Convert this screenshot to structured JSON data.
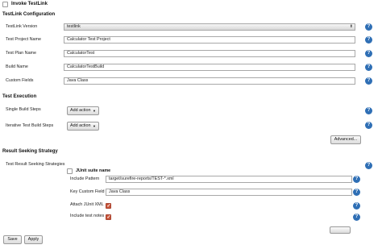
{
  "invoke": {
    "label": "Invoke TestLink"
  },
  "config": {
    "header": "TestLink Configuration",
    "version": {
      "label": "TestLink Version",
      "value": "testlink"
    },
    "project": {
      "label": "Test Project Name",
      "value": "Calculator Test Project"
    },
    "plan": {
      "label": "Test Plan Name",
      "value": "CalculatorTest"
    },
    "build": {
      "label": "Build Name",
      "value": "CalculatorTestBuild"
    },
    "custom": {
      "label": "Custom Fields",
      "value": "Java Class"
    }
  },
  "execution": {
    "header": "Test Execution",
    "single": {
      "label": "Single Build Steps",
      "button": "Add action"
    },
    "iterative": {
      "label": "Iterative Test Build Steps",
      "button": "Add action"
    },
    "advanced": "Advanced..."
  },
  "result": {
    "header": "Result Seeking Strategy",
    "strategies_label": "Test Result Seeking Strategies",
    "junit": {
      "title": "JUnit suite name",
      "include_pattern": {
        "label": "Include Pattern",
        "value": "target/surefire-reports/TEST-*.xml"
      },
      "key_custom_field": {
        "label": "Key Custom Field",
        "value": "Java Class"
      },
      "attach_junit_xml": {
        "label": "Attach JUnit XML",
        "checked": true
      },
      "include_test_notes": {
        "label": "Include test notes",
        "checked": true
      }
    }
  },
  "footer": {
    "save": "Save",
    "apply": "Apply"
  },
  "colors": {
    "help": "#2f6fb5",
    "checkbox": "#c9553a"
  }
}
